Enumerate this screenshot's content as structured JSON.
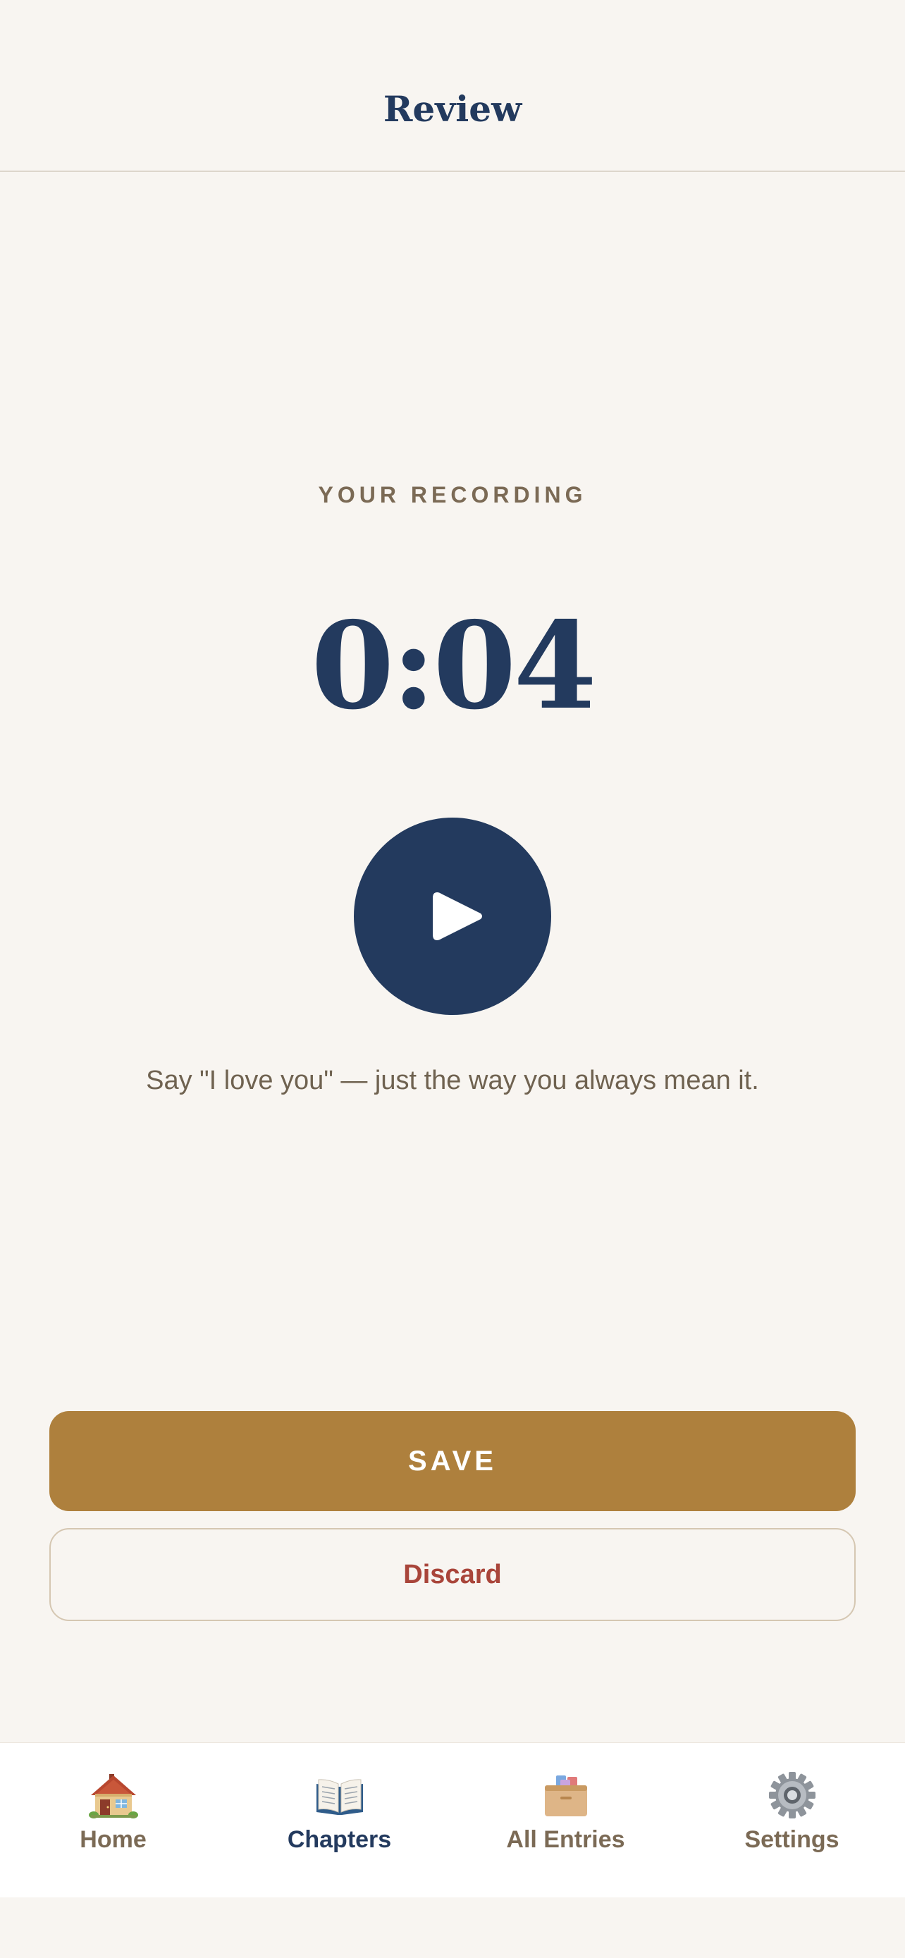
{
  "header": {
    "title": "Review"
  },
  "recording": {
    "label": "YOUR RECORDING",
    "duration": "0:04",
    "play_icon": "play-icon",
    "prompt": "Say \"I love you\" — just the way you always mean it."
  },
  "actions": {
    "save_label": "SAVE",
    "discard_label": "Discard"
  },
  "tabs": [
    {
      "label": "Home",
      "icon": "house-icon",
      "active": false
    },
    {
      "label": "Chapters",
      "icon": "open-book-icon",
      "active": true
    },
    {
      "label": "All Entries",
      "icon": "card-file-box-icon",
      "active": false
    },
    {
      "label": "Settings",
      "icon": "gear-icon",
      "active": false
    }
  ],
  "colors": {
    "background": "#f8f5f1",
    "navy": "#233a5e",
    "gold": "#ae803d",
    "discard_red": "#a9453a",
    "muted_brown": "#7b6a55"
  }
}
